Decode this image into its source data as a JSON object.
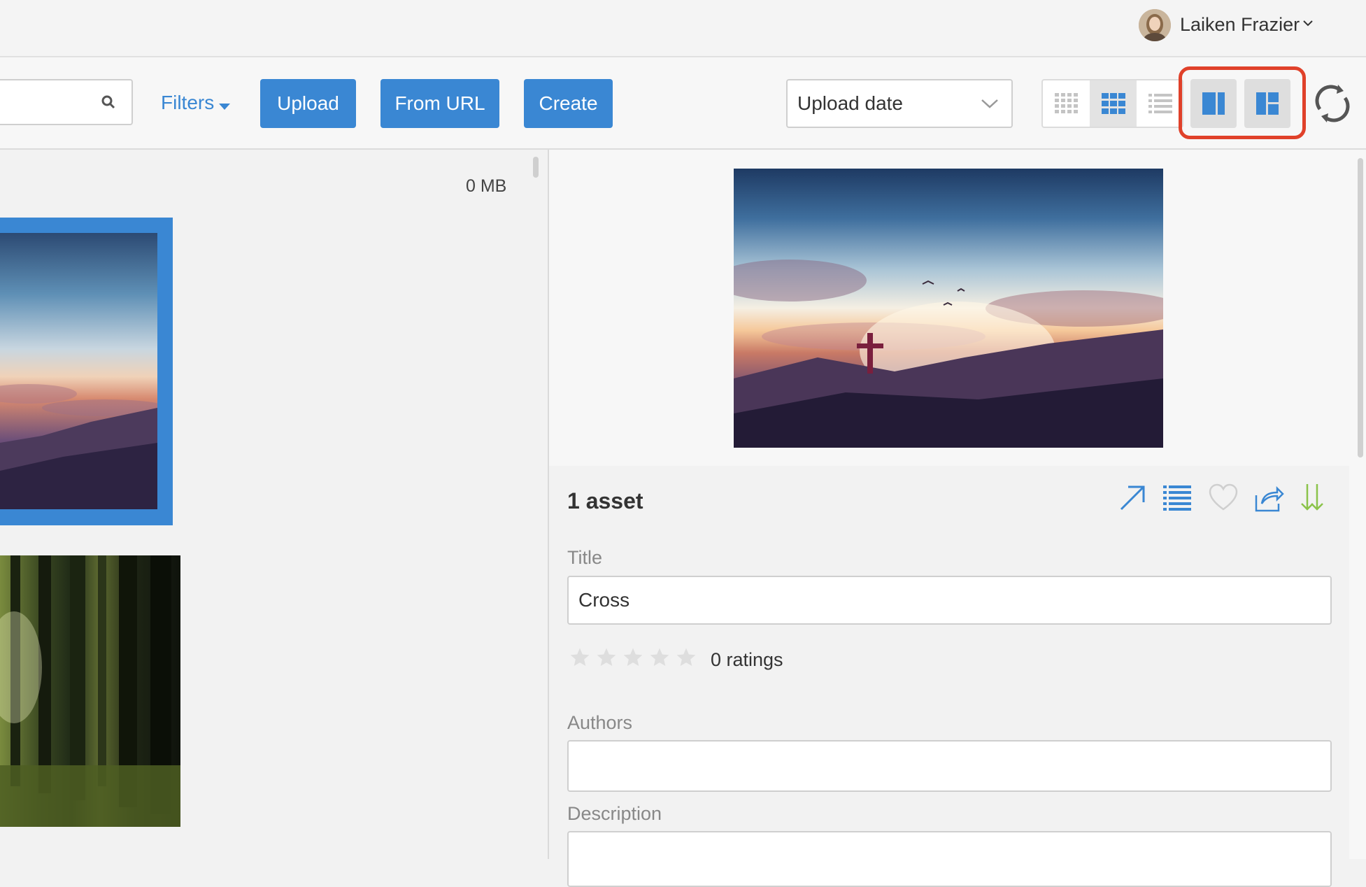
{
  "header": {
    "user_name": "Laiken Frazier"
  },
  "toolbar": {
    "search_placeholder": "",
    "filters_label": "Filters",
    "upload_label": "Upload",
    "from_url_label": "From URL",
    "create_label": "Create",
    "sort_value": "Upload date",
    "view_modes": [
      "small-grid",
      "medium-grid",
      "list",
      "split",
      "masonry"
    ],
    "active_view": "medium-grid"
  },
  "gallery": {
    "size_label": "0 MB",
    "thumbnails": [
      "cross-sunset",
      "forest"
    ]
  },
  "detail": {
    "asset_count": "1 asset",
    "title_label": "Title",
    "title_value": "Cross",
    "rating_value": 0,
    "ratings_label": "0 ratings",
    "authors_label": "Authors",
    "authors_value": "",
    "description_label": "Description",
    "description_value": ""
  },
  "colors": {
    "accent": "#3a87d3",
    "highlight": "#e0412a",
    "download": "#8bc34a"
  }
}
